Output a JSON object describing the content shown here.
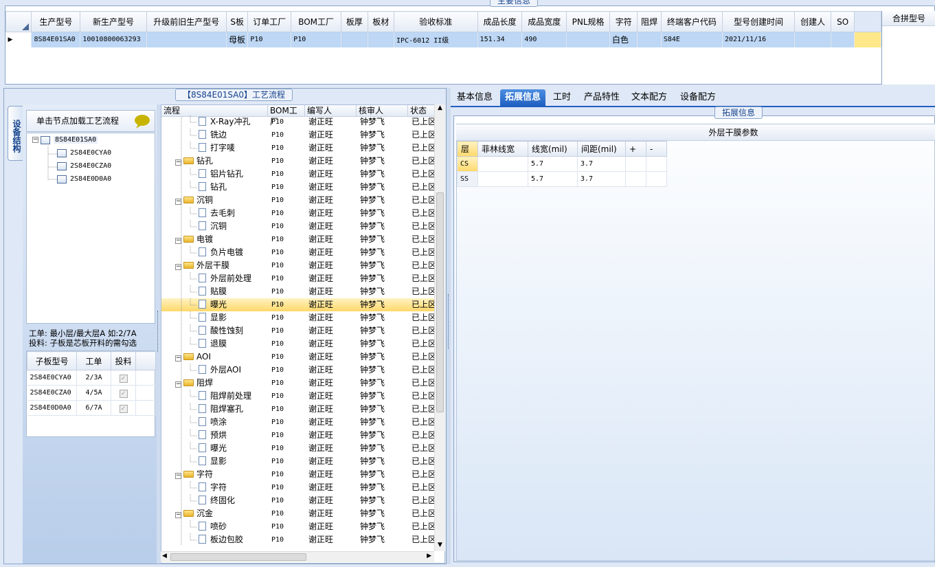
{
  "top": {
    "title": "主要信息",
    "columns": [
      "生产型号",
      "新生产型号",
      "升级前旧生产型号",
      "S板",
      "订单工厂",
      "BOM工厂",
      "板厚",
      "板材",
      "验收标准",
      "成品长度",
      "成品宽度",
      "PNL规格",
      "字符",
      "阻焊",
      "终端客户代码",
      "型号创建时间",
      "创建人",
      "SO"
    ],
    "row": [
      "8S84E01SA0",
      "10010800063293",
      "",
      "母板",
      "P10",
      "P10",
      "",
      "",
      "IPC-6012 II级",
      "151.34",
      "490",
      "",
      "白色",
      "",
      "S84E",
      "2021/11/16",
      "",
      ""
    ],
    "merge_label": "合拼型号"
  },
  "flow": {
    "title": "【8S84E01SA0】工艺流程",
    "headers": [
      "流程",
      "BOM工厂",
      "编写人",
      "核审人",
      "状态"
    ],
    "rows": [
      {
        "name": "X-Ray冲孔",
        "type": "leaf",
        "bom": "P10",
        "writer": "谢正旺",
        "reviewer": "钟梦飞",
        "status": "已上区"
      },
      {
        "name": "铣边",
        "type": "leaf",
        "bom": "P10",
        "writer": "谢正旺",
        "reviewer": "钟梦飞",
        "status": "已上区"
      },
      {
        "name": "打字唛",
        "type": "leaf",
        "bom": "P10",
        "writer": "谢正旺",
        "reviewer": "钟梦飞",
        "status": "已上区"
      },
      {
        "name": "钻孔",
        "type": "folder",
        "bom": "P10",
        "writer": "谢正旺",
        "reviewer": "钟梦飞",
        "status": "已上区"
      },
      {
        "name": "铝片钻孔",
        "type": "leaf",
        "bom": "P10",
        "writer": "谢正旺",
        "reviewer": "钟梦飞",
        "status": "已上区"
      },
      {
        "name": "钻孔",
        "type": "leaf",
        "bom": "P10",
        "writer": "谢正旺",
        "reviewer": "钟梦飞",
        "status": "已上区"
      },
      {
        "name": "沉铜",
        "type": "folder",
        "bom": "P10",
        "writer": "谢正旺",
        "reviewer": "钟梦飞",
        "status": "已上区"
      },
      {
        "name": "去毛刺",
        "type": "leaf",
        "bom": "P10",
        "writer": "谢正旺",
        "reviewer": "钟梦飞",
        "status": "已上区"
      },
      {
        "name": "沉铜",
        "type": "leaf",
        "bom": "P10",
        "writer": "谢正旺",
        "reviewer": "钟梦飞",
        "status": "已上区"
      },
      {
        "name": "电镀",
        "type": "folder",
        "bom": "P10",
        "writer": "谢正旺",
        "reviewer": "钟梦飞",
        "status": "已上区"
      },
      {
        "name": "负片电镀",
        "type": "leaf",
        "bom": "P10",
        "writer": "谢正旺",
        "reviewer": "钟梦飞",
        "status": "已上区"
      },
      {
        "name": "外层干膜",
        "type": "folder",
        "bom": "P10",
        "writer": "谢正旺",
        "reviewer": "钟梦飞",
        "status": "已上区"
      },
      {
        "name": "外层前处理",
        "type": "leaf",
        "bom": "P10",
        "writer": "谢正旺",
        "reviewer": "钟梦飞",
        "status": "已上区"
      },
      {
        "name": "贴膜",
        "type": "leaf",
        "bom": "P10",
        "writer": "谢正旺",
        "reviewer": "钟梦飞",
        "status": "已上区"
      },
      {
        "name": "曝光",
        "type": "leaf",
        "bom": "P10",
        "writer": "谢正旺",
        "reviewer": "钟梦飞",
        "status": "已上区",
        "selected": true
      },
      {
        "name": "显影",
        "type": "leaf",
        "bom": "P10",
        "writer": "谢正旺",
        "reviewer": "钟梦飞",
        "status": "已上区"
      },
      {
        "name": "酸性蚀刻",
        "type": "leaf",
        "bom": "P10",
        "writer": "谢正旺",
        "reviewer": "钟梦飞",
        "status": "已上区"
      },
      {
        "name": "退膜",
        "type": "leaf",
        "bom": "P10",
        "writer": "谢正旺",
        "reviewer": "钟梦飞",
        "status": "已上区"
      },
      {
        "name": "AOI",
        "type": "folder",
        "bom": "P10",
        "writer": "谢正旺",
        "reviewer": "钟梦飞",
        "status": "已上区"
      },
      {
        "name": "外层AOI",
        "type": "leaf",
        "bom": "P10",
        "writer": "谢正旺",
        "reviewer": "钟梦飞",
        "status": "已上区"
      },
      {
        "name": "阻焊",
        "type": "folder",
        "bom": "P10",
        "writer": "谢正旺",
        "reviewer": "钟梦飞",
        "status": "已上区"
      },
      {
        "name": "阻焊前处理",
        "type": "leaf",
        "bom": "P10",
        "writer": "谢正旺",
        "reviewer": "钟梦飞",
        "status": "已上区"
      },
      {
        "name": "阻焊塞孔",
        "type": "leaf",
        "bom": "P10",
        "writer": "谢正旺",
        "reviewer": "钟梦飞",
        "status": "已上区"
      },
      {
        "name": "喷涂",
        "type": "leaf",
        "bom": "P10",
        "writer": "谢正旺",
        "reviewer": "钟梦飞",
        "status": "已上区"
      },
      {
        "name": "预烘",
        "type": "leaf",
        "bom": "P10",
        "writer": "谢正旺",
        "reviewer": "钟梦飞",
        "status": "已上区"
      },
      {
        "name": "曝光",
        "type": "leaf",
        "bom": "P10",
        "writer": "谢正旺",
        "reviewer": "钟梦飞",
        "status": "已上区"
      },
      {
        "name": "显影",
        "type": "leaf",
        "bom": "P10",
        "writer": "谢正旺",
        "reviewer": "钟梦飞",
        "status": "已上区"
      },
      {
        "name": "字符",
        "type": "folder",
        "bom": "P10",
        "writer": "谢正旺",
        "reviewer": "钟梦飞",
        "status": "已上区"
      },
      {
        "name": "字符",
        "type": "leaf",
        "bom": "P10",
        "writer": "谢正旺",
        "reviewer": "钟梦飞",
        "status": "已上区"
      },
      {
        "name": "终固化",
        "type": "leaf",
        "bom": "P10",
        "writer": "谢正旺",
        "reviewer": "钟梦飞",
        "status": "已上区"
      },
      {
        "name": "沉金",
        "type": "folder",
        "bom": "P10",
        "writer": "谢正旺",
        "reviewer": "钟梦飞",
        "status": "已上区"
      },
      {
        "name": "喷砂",
        "type": "leaf",
        "bom": "P10",
        "writer": "谢正旺",
        "reviewer": "钟梦飞",
        "status": "已上区"
      },
      {
        "name": "板边包胶",
        "type": "leaf",
        "bom": "P10",
        "writer": "谢正旺",
        "reviewer": "钟梦飞",
        "status": "已上区"
      }
    ]
  },
  "left": {
    "vtab": "设备结构",
    "load_label": "单击节点加载工艺流程",
    "tree_root": "8S84E01SA0",
    "tree_children": [
      "2S84E0CYA0",
      "2S84E0CZA0",
      "2S84E0D0A0"
    ],
    "hint1": "工单: 最小层/最大层A 如:2/7A",
    "hint2": "投料: 子板是芯板开料的需勾选",
    "sub_headers": [
      "子板型号",
      "工单",
      "投料"
    ],
    "sub_rows": [
      {
        "model": "2S84E0CYA0",
        "order": "2/3A"
      },
      {
        "model": "2S84E0CZA0",
        "order": "4/5A"
      },
      {
        "model": "2S84E0D0A0",
        "order": "6/7A"
      }
    ]
  },
  "right": {
    "tabs": [
      "基本信息",
      "拓展信息",
      "工时",
      "产品特性",
      "文本配方",
      "设备配方"
    ],
    "active_tab": 1,
    "group_title": "拓展信息",
    "table_title": "外层干膜参数",
    "headers": [
      "层",
      "菲林线宽",
      "线宽(mil)",
      "间距(mil)",
      "+",
      "-"
    ],
    "rows": [
      [
        "CS",
        "",
        "5.7",
        "3.7",
        "",
        ""
      ],
      [
        "SS",
        "",
        "5.7",
        "3.7",
        "",
        ""
      ]
    ]
  }
}
